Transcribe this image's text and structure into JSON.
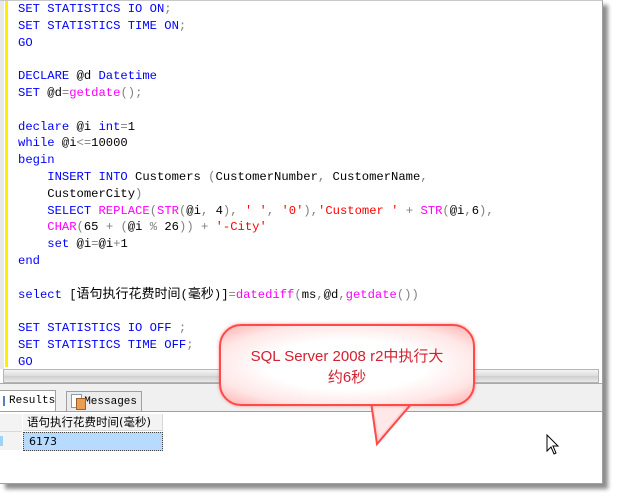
{
  "editor": {
    "lines": [
      [
        {
          "t": "SET STATISTICS IO ON",
          "c": "kw"
        },
        {
          "t": ";",
          "c": "op"
        }
      ],
      [
        {
          "t": "SET STATISTICS TIME ON",
          "c": "kw"
        },
        {
          "t": ";",
          "c": "op"
        }
      ],
      [
        {
          "t": "GO",
          "c": "kw"
        }
      ],
      [],
      [
        {
          "t": "DECLARE",
          "c": "kw"
        },
        {
          "t": " @d ",
          "c": ""
        },
        {
          "t": "Datetime",
          "c": "kw"
        }
      ],
      [
        {
          "t": "SET",
          "c": "kw"
        },
        {
          "t": " @d",
          "c": ""
        },
        {
          "t": "=",
          "c": "op"
        },
        {
          "t": "getdate",
          "c": "fn"
        },
        {
          "t": "();",
          "c": "op"
        }
      ],
      [],
      [
        {
          "t": "declare",
          "c": "kw"
        },
        {
          "t": " @i ",
          "c": ""
        },
        {
          "t": "int",
          "c": "kw"
        },
        {
          "t": "=",
          "c": "op"
        },
        {
          "t": "1",
          "c": ""
        }
      ],
      [
        {
          "t": "while",
          "c": "kw"
        },
        {
          "t": " @i",
          "c": ""
        },
        {
          "t": "<=",
          "c": "op"
        },
        {
          "t": "10000",
          "c": ""
        }
      ],
      [
        {
          "t": "begin",
          "c": "kw"
        }
      ],
      [
        {
          "t": "    ",
          "c": ""
        },
        {
          "t": "INSERT INTO",
          "c": "kw"
        },
        {
          "t": " Customers ",
          "c": ""
        },
        {
          "t": "(",
          "c": "op"
        },
        {
          "t": "CustomerNumber",
          "c": ""
        },
        {
          "t": ", ",
          "c": "op"
        },
        {
          "t": "CustomerName",
          "c": ""
        },
        {
          "t": ",",
          "c": "op"
        }
      ],
      [
        {
          "t": "    CustomerCity",
          "c": ""
        },
        {
          "t": ")",
          "c": "op"
        }
      ],
      [
        {
          "t": "    ",
          "c": ""
        },
        {
          "t": "SELECT",
          "c": "kw"
        },
        {
          "t": " ",
          "c": ""
        },
        {
          "t": "REPLACE",
          "c": "fn"
        },
        {
          "t": "(",
          "c": "op"
        },
        {
          "t": "STR",
          "c": "fn"
        },
        {
          "t": "(",
          "c": "op"
        },
        {
          "t": "@i",
          "c": ""
        },
        {
          "t": ", ",
          "c": "op"
        },
        {
          "t": "4",
          "c": ""
        },
        {
          "t": "), ",
          "c": "op"
        },
        {
          "t": "' '",
          "c": "str"
        },
        {
          "t": ", ",
          "c": "op"
        },
        {
          "t": "'0'",
          "c": "str"
        },
        {
          "t": "),",
          "c": "op"
        },
        {
          "t": "'Customer '",
          "c": "str"
        },
        {
          "t": " + ",
          "c": "op"
        },
        {
          "t": "STR",
          "c": "fn"
        },
        {
          "t": "(",
          "c": "op"
        },
        {
          "t": "@i",
          "c": ""
        },
        {
          "t": ",",
          "c": "op"
        },
        {
          "t": "6",
          "c": ""
        },
        {
          "t": "),",
          "c": "op"
        }
      ],
      [
        {
          "t": "    ",
          "c": ""
        },
        {
          "t": "CHAR",
          "c": "fn"
        },
        {
          "t": "(",
          "c": "op"
        },
        {
          "t": "65 ",
          "c": ""
        },
        {
          "t": "+ (",
          "c": "op"
        },
        {
          "t": "@i ",
          "c": ""
        },
        {
          "t": "%",
          "c": "op"
        },
        {
          "t": " 26",
          "c": ""
        },
        {
          "t": ")) + ",
          "c": "op"
        },
        {
          "t": "'-City'",
          "c": "str"
        }
      ],
      [
        {
          "t": "    ",
          "c": ""
        },
        {
          "t": "set",
          "c": "kw"
        },
        {
          "t": " @i",
          "c": ""
        },
        {
          "t": "=",
          "c": "op"
        },
        {
          "t": "@i",
          "c": ""
        },
        {
          "t": "+",
          "c": "op"
        },
        {
          "t": "1",
          "c": ""
        }
      ],
      [
        {
          "t": "end",
          "c": "kw"
        }
      ],
      [],
      [
        {
          "t": "select",
          "c": "kw"
        },
        {
          "t": " [",
          "c": ""
        },
        {
          "t": "语句执行花费时间",
          "c": "cjk"
        },
        {
          "t": "(",
          "c": ""
        },
        {
          "t": "毫秒",
          "c": "cjk"
        },
        {
          "t": ")]",
          "c": ""
        },
        {
          "t": "=",
          "c": "op"
        },
        {
          "t": "datediff",
          "c": "fn"
        },
        {
          "t": "(",
          "c": "op"
        },
        {
          "t": "ms",
          "c": ""
        },
        {
          "t": ",",
          "c": "op"
        },
        {
          "t": "@d",
          "c": ""
        },
        {
          "t": ",",
          "c": "op"
        },
        {
          "t": "getdate",
          "c": "fn"
        },
        {
          "t": "())",
          "c": "op"
        }
      ],
      [],
      [
        {
          "t": "SET STATISTICS IO OFF",
          "c": "kw"
        },
        {
          "t": " ;",
          "c": "op"
        }
      ],
      [
        {
          "t": "SET STATISTICS TIME OFF",
          "c": "kw"
        },
        {
          "t": ";",
          "c": "op"
        }
      ],
      [
        {
          "t": "GO",
          "c": "kw"
        }
      ]
    ]
  },
  "tabs": {
    "results_label": "Results",
    "messages_label": "Messages",
    "active": "Results"
  },
  "results": {
    "columns": [
      "语句执行花费时间(毫秒)"
    ],
    "rows": [
      [
        "6173"
      ]
    ]
  },
  "callout": {
    "line1": "SQL Server 2008 r2中执行大",
    "line2": "约6秒"
  },
  "colors": {
    "keyword": "#0000ff",
    "function": "#ff00ff",
    "string": "#ff0000",
    "operator": "#808080",
    "callout_border": "#ff4a4a",
    "callout_text": "#d42030",
    "selected_cell": "#b7dbff"
  }
}
